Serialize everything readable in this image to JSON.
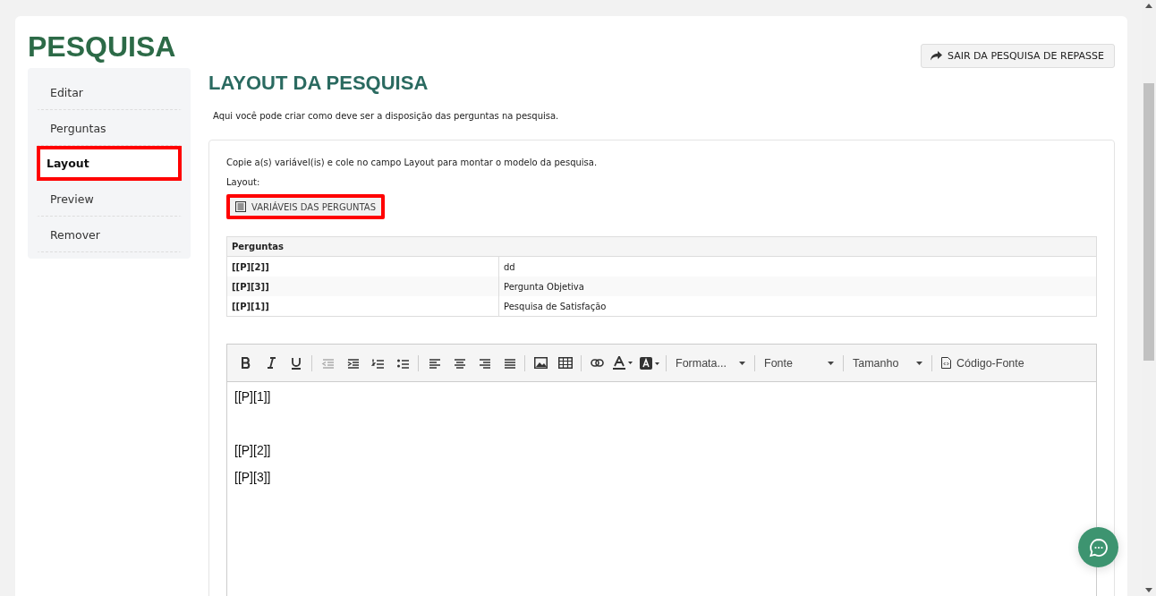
{
  "page_title": "PESQUISA",
  "exit_button": {
    "label": "SAIR DA PESQUISA DE REPASSE"
  },
  "sidebar": {
    "items": [
      {
        "label": "Editar",
        "selected": false,
        "highlighted": false
      },
      {
        "label": "Perguntas",
        "selected": false,
        "highlighted": false
      },
      {
        "label": "Layout",
        "selected": true,
        "highlighted": true
      },
      {
        "label": "Preview",
        "selected": false,
        "highlighted": false
      },
      {
        "label": "Remover",
        "selected": false,
        "highlighted": false
      }
    ]
  },
  "section_title": "LAYOUT DA PESQUISA",
  "description": "Aqui você pode criar como deve ser a disposição das perguntas na pesquisa.",
  "instructions": "Copie a(s) variável(is) e cole no campo Layout para montar o modelo da pesquisa.",
  "layout_label": "Layout:",
  "variables_button": {
    "label": "VARIÁVEIS DAS PERGUNTAS",
    "highlighted": true
  },
  "table": {
    "heading": "Perguntas",
    "rows": [
      {
        "variable": "[[P][2]]",
        "question": "dd"
      },
      {
        "variable": "[[P][3]]",
        "question": "Pergunta Objetiva"
      },
      {
        "variable": "[[P][1]]",
        "question": "Pesquisa de Satisfação"
      }
    ]
  },
  "editor": {
    "toolbar": [
      {
        "kind": "bold",
        "disabled": false
      },
      {
        "kind": "italic",
        "disabled": false
      },
      {
        "kind": "underline",
        "disabled": false
      },
      {
        "kind": "sep"
      },
      {
        "kind": "outdent",
        "disabled": true
      },
      {
        "kind": "indent",
        "disabled": false
      },
      {
        "kind": "numbered",
        "disabled": false
      },
      {
        "kind": "bullets",
        "disabled": false
      },
      {
        "kind": "sep"
      },
      {
        "kind": "align-left",
        "disabled": false
      },
      {
        "kind": "align-center",
        "disabled": false
      },
      {
        "kind": "align-right",
        "disabled": false
      },
      {
        "kind": "justify",
        "disabled": false
      },
      {
        "kind": "sep"
      },
      {
        "kind": "image",
        "disabled": false
      },
      {
        "kind": "table",
        "disabled": false
      },
      {
        "kind": "sep"
      },
      {
        "kind": "link",
        "disabled": false
      },
      {
        "kind": "text-color",
        "disabled": false
      },
      {
        "kind": "bg-color",
        "disabled": false
      },
      {
        "kind": "sep"
      },
      {
        "kind": "dropdown",
        "label": "Formata..."
      },
      {
        "kind": "sep"
      },
      {
        "kind": "dropdown",
        "label": "Fonte"
      },
      {
        "kind": "sep"
      },
      {
        "kind": "dropdown",
        "label": "Tamanho"
      },
      {
        "kind": "sep"
      },
      {
        "kind": "source",
        "label": "Código-Fonte"
      }
    ],
    "lines": [
      "[[P][1]]",
      "[[P][2]]",
      "[[P][3]]"
    ]
  }
}
